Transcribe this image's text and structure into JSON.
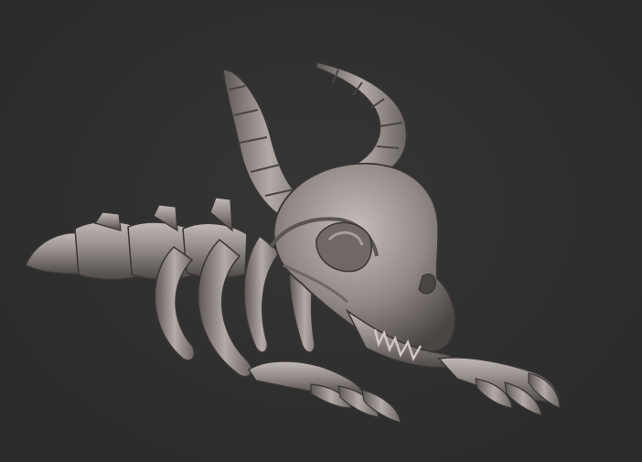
{
  "scene": {
    "subject": "dragon-skeleton-sculpt",
    "colors": {
      "background": "#2f2f2f",
      "clay_light": "#b9b1ad",
      "clay_mid": "#8e8683",
      "clay_dark": "#5a5452",
      "clay_shadow": "#3c3837"
    }
  }
}
